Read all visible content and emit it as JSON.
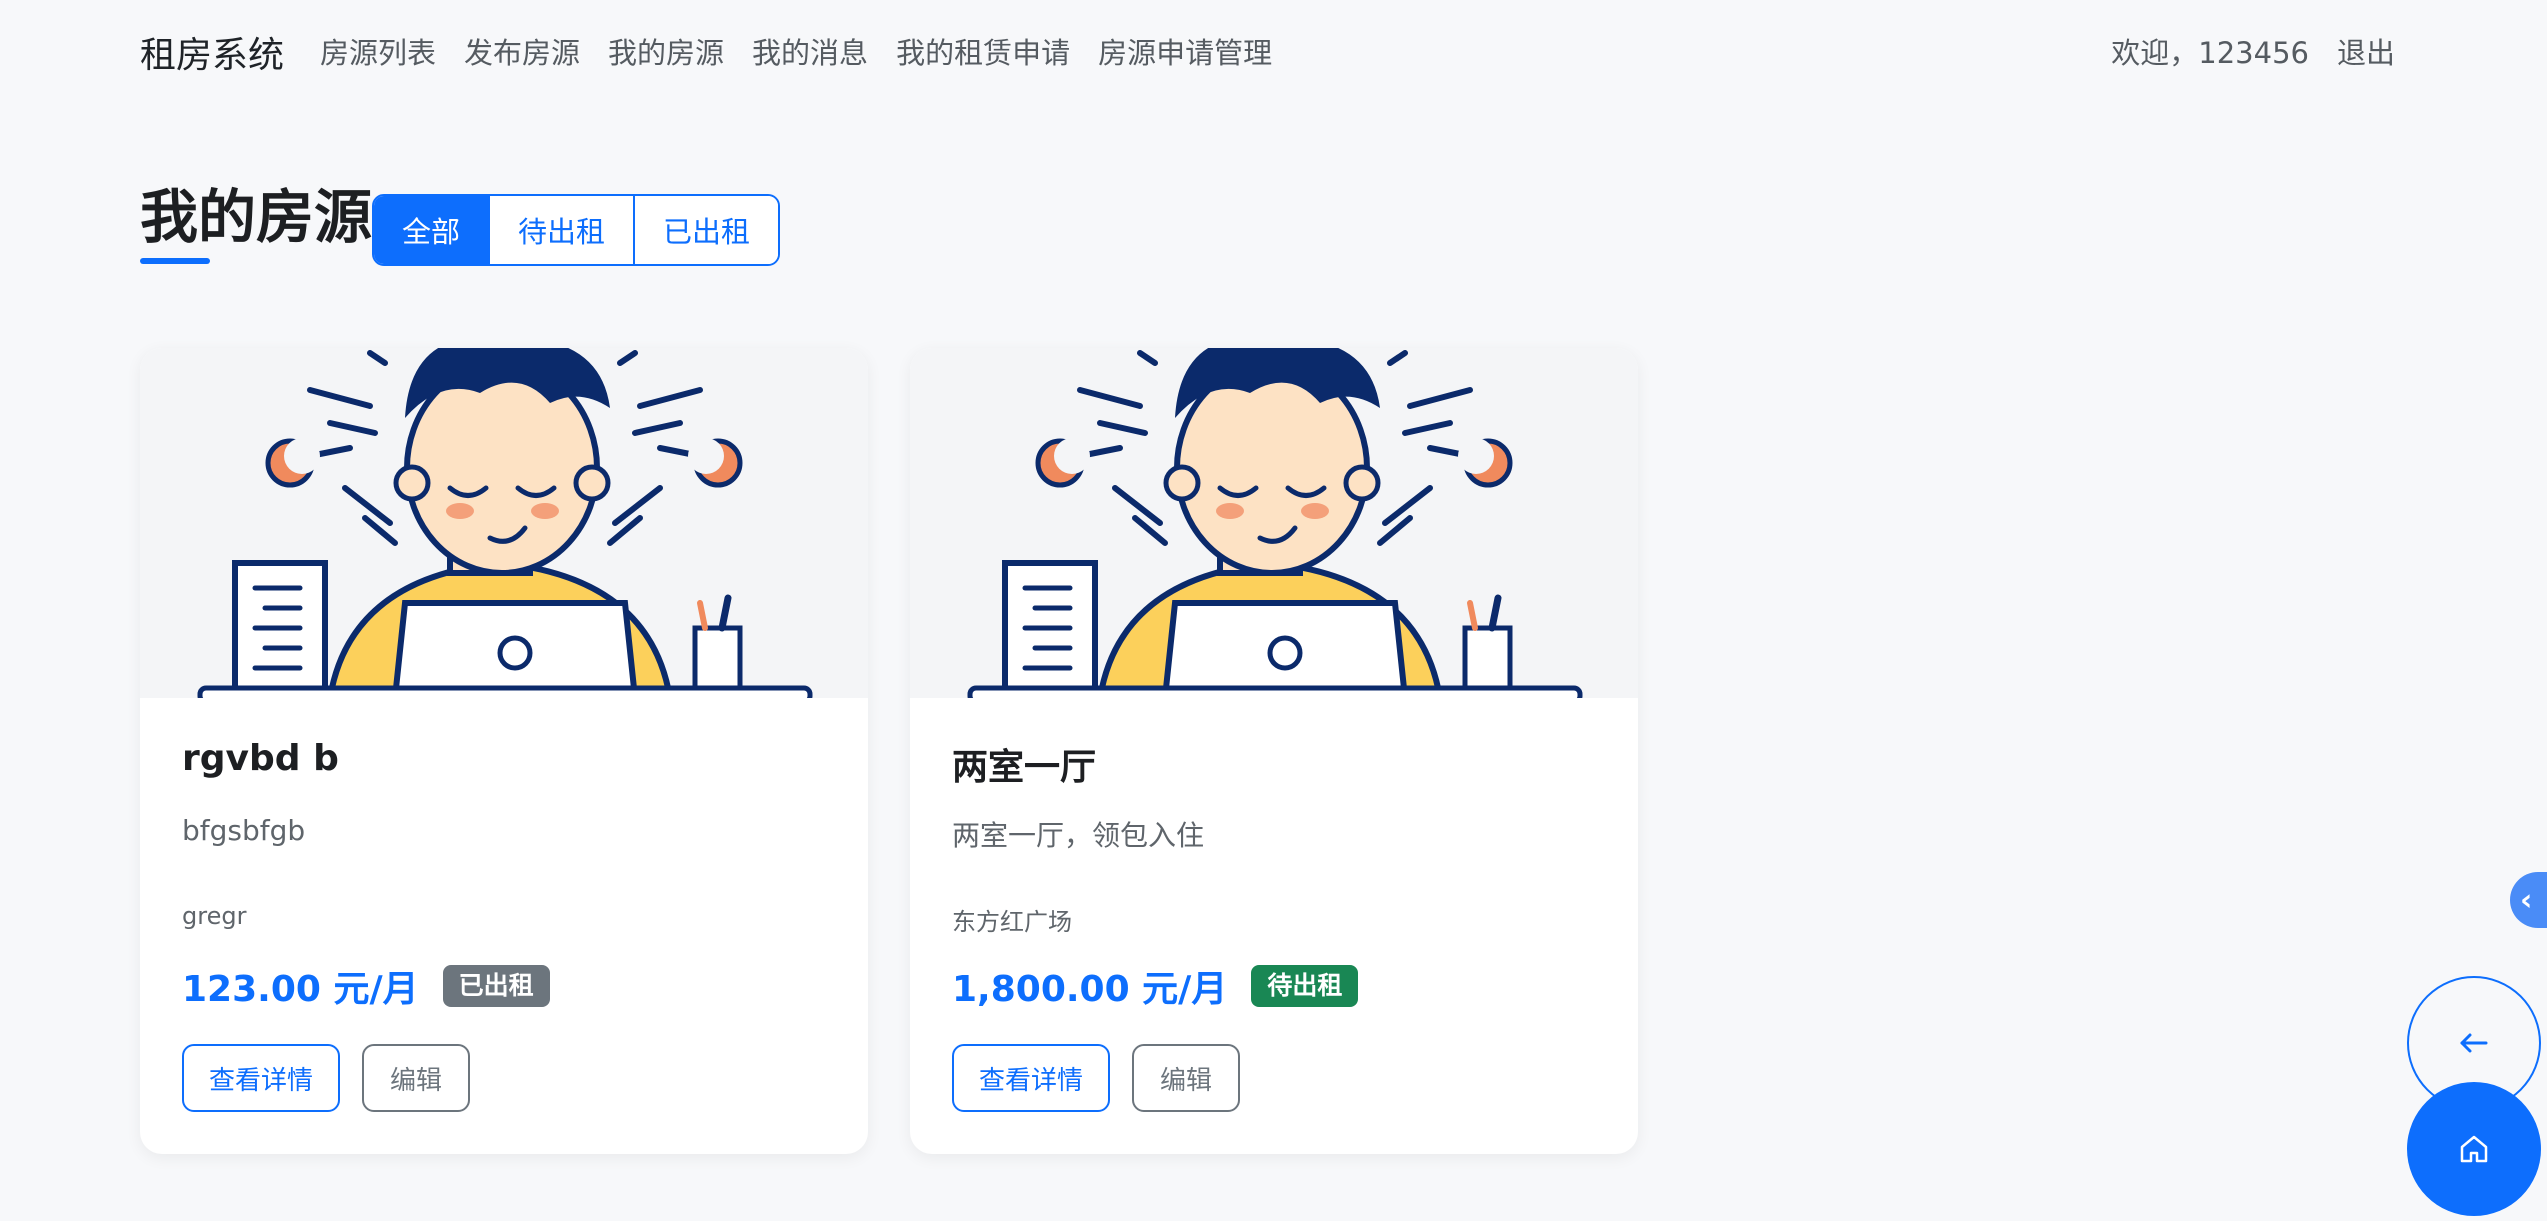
{
  "navbar": {
    "brand": "租房系统",
    "links": [
      {
        "label": "房源列表"
      },
      {
        "label": "发布房源"
      },
      {
        "label": "我的房源"
      },
      {
        "label": "我的消息"
      },
      {
        "label": "我的租赁申请"
      },
      {
        "label": "房源申请管理"
      }
    ],
    "welcome": "欢迎，123456",
    "logout": "退出"
  },
  "page": {
    "title": "我的房源",
    "filters": [
      {
        "label": "全部",
        "active": true
      },
      {
        "label": "待出租",
        "active": false
      },
      {
        "label": "已出租",
        "active": false
      }
    ]
  },
  "listings": [
    {
      "title": "rgvbd b",
      "description": "bfgsbfgb",
      "location": "gregr",
      "price": "123.00 元/月",
      "status": "已出租",
      "status_color": "#6c757d",
      "detail_label": "查看详情",
      "edit_label": "编辑",
      "image": "person-with-laptop-illustration"
    },
    {
      "title": "两室一厅",
      "description": "两室一厅，领包入住",
      "location": "东方红广场",
      "price": "1,800.00 元/月",
      "status": "待出租",
      "status_color": "#198754",
      "detail_label": "查看详情",
      "edit_label": "编辑",
      "image": "person-with-laptop-illustration"
    }
  ],
  "floating": {
    "side_tab_icon": "chevron-left-icon",
    "back_icon": "arrow-left-icon",
    "home_icon": "home-icon"
  },
  "colors": {
    "primary": "#0d6efd",
    "background": "#f7f8fa"
  }
}
